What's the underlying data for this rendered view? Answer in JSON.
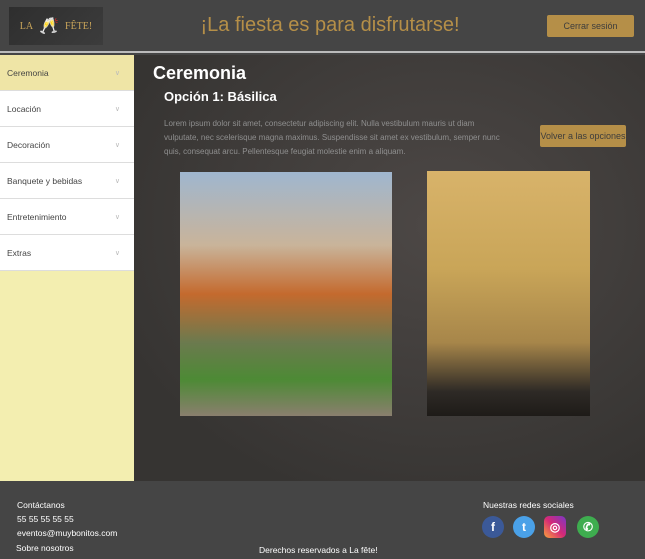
{
  "header": {
    "logo_text_left": "LA",
    "logo_text_right": "FÊTE!",
    "title": "¡La fiesta es para disfrutarse!",
    "logout": "Cerrar sesión"
  },
  "sidebar": {
    "items": [
      {
        "label": "Ceremonia"
      },
      {
        "label": "Locación"
      },
      {
        "label": "Decoración"
      },
      {
        "label": "Banquete y bebidas"
      },
      {
        "label": "Entretenimiento"
      },
      {
        "label": "Extras"
      }
    ]
  },
  "main": {
    "title": "Ceremonia",
    "subtitle": "Opción 1:  Básilica",
    "description": "Lorem ipsum dolor sit amet, consectetur adipiscing elit. Nulla vestibulum mauris ut diam vulputate, nec scelerisque magna maximus. Suspendisse sit amet ex vestibulum, semper nunc quis, consequat arcu. Pellentesque feugiat molestie enim a aliquam.",
    "back": "Volver a las opciones"
  },
  "footer": {
    "contact_title": "Contáctanos",
    "phone": "55 55 55 55 55",
    "email": "eventos@muybonitos.com",
    "about": "Sobre nosotros",
    "copyright": "Derechos reservados a La fête!",
    "social_title": "Nuestras redes sociales"
  },
  "colors": {
    "accent": "#b58f48",
    "sidebar_active": "#efe5a6",
    "sidebar_bg": "#f3eeb0"
  }
}
